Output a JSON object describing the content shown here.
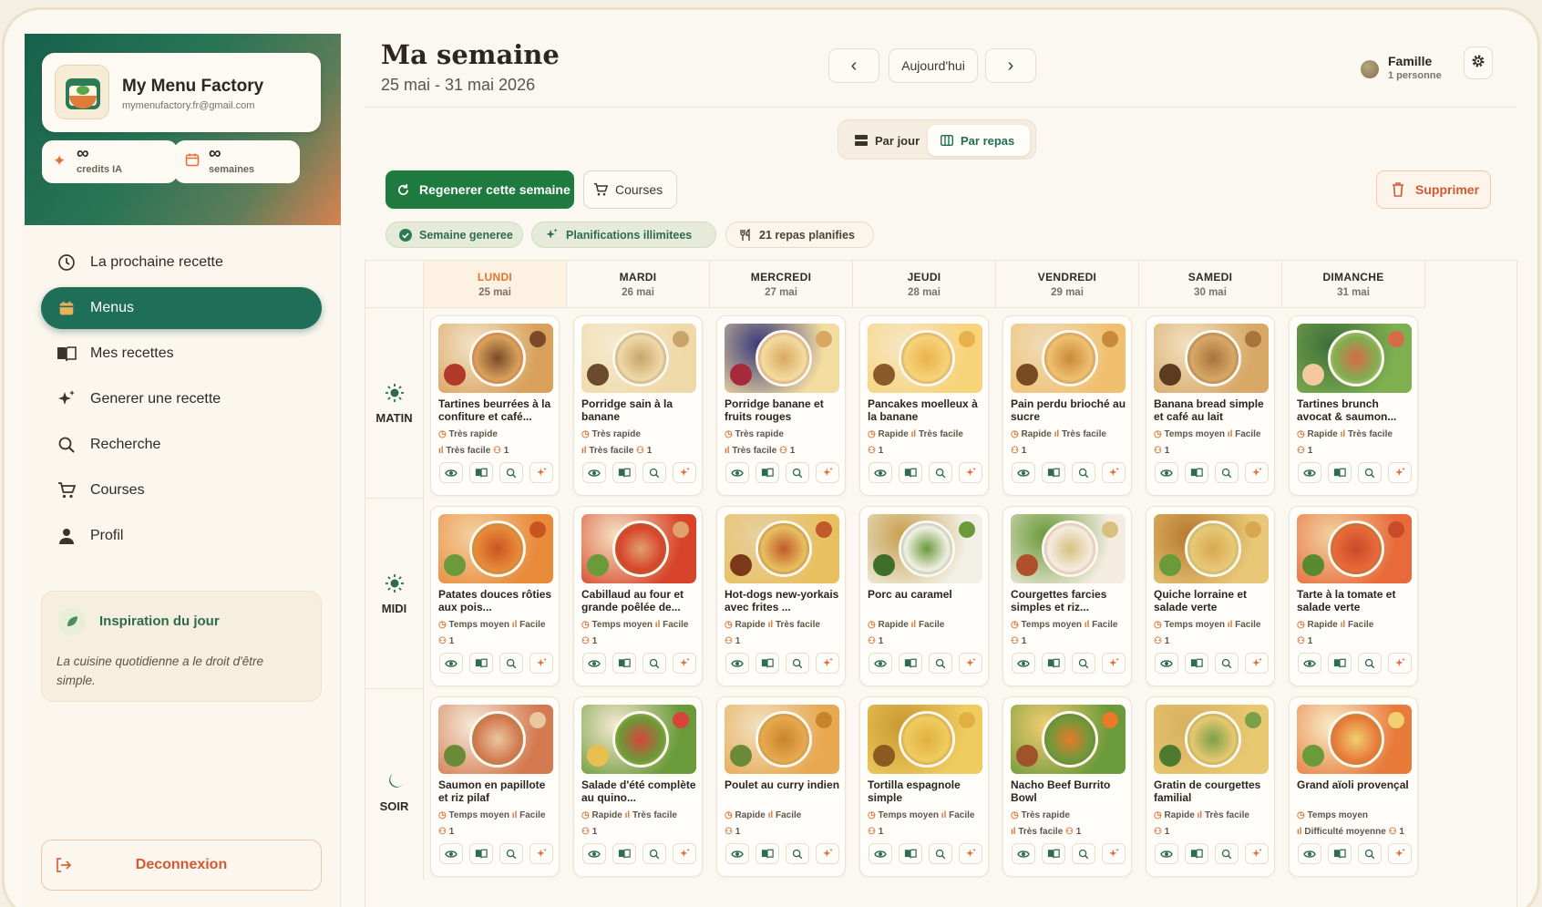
{
  "brand": {
    "name": "My Menu Factory",
    "email": "mymenufactory.fr@gmail.com"
  },
  "stats": [
    {
      "value": "∞",
      "label": "credits IA",
      "icon": "sparkle-icon"
    },
    {
      "value": "∞",
      "label": "semaines",
      "icon": "calendar-icon"
    }
  ],
  "nav": [
    {
      "label": "La prochaine recette",
      "icon": "clock-icon",
      "active": false
    },
    {
      "label": "Menus",
      "icon": "calendar-icon",
      "active": true
    },
    {
      "label": "Mes recettes",
      "icon": "book-icon",
      "active": false
    },
    {
      "label": "Generer une recette",
      "icon": "sparkle-icon",
      "active": false
    },
    {
      "label": "Recherche",
      "icon": "search-icon",
      "active": false
    },
    {
      "label": "Courses",
      "icon": "cart-icon",
      "active": false
    },
    {
      "label": "Profil",
      "icon": "user-icon",
      "active": false
    }
  ],
  "inspiration": {
    "title": "Inspiration du jour",
    "text": "La cuisine quotidienne a le droit d'être simple."
  },
  "logout": {
    "label": "Deconnexion"
  },
  "header": {
    "title": "Ma semaine",
    "range": "25 mai - 31 mai 2026",
    "prev": "‹",
    "today": "Aujourd'hui",
    "next": "›",
    "user": {
      "name": "Famille",
      "sub": "1 personne"
    }
  },
  "view_toggle": {
    "by_day": "Par jour",
    "by_meal": "Par repas",
    "selected": "Par repas"
  },
  "actions": {
    "regenerate": "Regenerer cette semaine",
    "courses": "Courses",
    "delete": "Supprimer"
  },
  "chips": [
    "Semaine generee",
    "Planifications illimitees",
    "21 repas planifies"
  ],
  "colors": {
    "primary": "#1f6e58",
    "action_green": "#1e7a3f",
    "accent_orange": "#e0772b",
    "danger": "#d25a32",
    "background": "#fbf8f1"
  },
  "days": [
    {
      "name": "LUNDI",
      "date": "25 mai",
      "today": true
    },
    {
      "name": "MARDI",
      "date": "26 mai",
      "today": false
    },
    {
      "name": "MERCREDI",
      "date": "27 mai",
      "today": false
    },
    {
      "name": "JEUDI",
      "date": "28 mai",
      "today": false
    },
    {
      "name": "VENDREDI",
      "date": "29 mai",
      "today": false
    },
    {
      "name": "SAMEDI",
      "date": "30 mai",
      "today": false
    },
    {
      "name": "DIMANCHE",
      "date": "31 mai",
      "today": false
    }
  ],
  "slots": [
    {
      "label": "MATIN",
      "icon": "sun-icon",
      "meals": [
        {
          "name": "Tartines beurrées à la confiture et café...",
          "time": "Très rapide",
          "difficulty": "Très facile",
          "servings": "1"
        },
        {
          "name": "Porridge sain à la banane",
          "time": "Très rapide",
          "difficulty": "Très facile",
          "servings": "1"
        },
        {
          "name": "Porridge banane et fruits rouges",
          "time": "Très rapide",
          "difficulty": "Très facile",
          "servings": "1"
        },
        {
          "name": "Pancakes moelleux à la banane",
          "time": "Rapide",
          "difficulty": "Très facile",
          "servings": "1"
        },
        {
          "name": "Pain perdu brioché au sucre",
          "time": "Rapide",
          "difficulty": "Très facile",
          "servings": "1"
        },
        {
          "name": "Banana bread simple et café au lait",
          "time": "Temps moyen",
          "difficulty": "Facile",
          "servings": "1"
        },
        {
          "name": "Tartines brunch avocat & saumon...",
          "time": "Rapide",
          "difficulty": "Très facile",
          "servings": "1"
        }
      ]
    },
    {
      "label": "MIDI",
      "icon": "sun-icon",
      "meals": [
        {
          "name": "Patates douces rôties aux pois...",
          "time": "Temps moyen",
          "difficulty": "Facile",
          "servings": "1"
        },
        {
          "name": "Cabillaud au four et grande poêlée de...",
          "time": "Temps moyen",
          "difficulty": "Facile",
          "servings": "1"
        },
        {
          "name": "Hot-dogs new-yorkais avec frites ...",
          "time": "Rapide",
          "difficulty": "Très facile",
          "servings": "1"
        },
        {
          "name": "Porc au caramel",
          "time": "Rapide",
          "difficulty": "Facile",
          "servings": "1"
        },
        {
          "name": "Courgettes farcies simples et riz...",
          "time": "Temps moyen",
          "difficulty": "Facile",
          "servings": "1"
        },
        {
          "name": "Quiche lorraine et salade verte",
          "time": "Temps moyen",
          "difficulty": "Facile",
          "servings": "1"
        },
        {
          "name": "Tarte à la tomate et salade verte",
          "time": "Rapide",
          "difficulty": "Facile",
          "servings": "1"
        }
      ]
    },
    {
      "label": "SOIR",
      "icon": "moon-icon",
      "meals": [
        {
          "name": "Saumon en papillote et riz pilaf",
          "time": "Temps moyen",
          "difficulty": "Facile",
          "servings": "1"
        },
        {
          "name": "Salade d'été complète au quino...",
          "time": "Rapide",
          "difficulty": "Très facile",
          "servings": "1"
        },
        {
          "name": "Poulet au curry indien",
          "time": "Rapide",
          "difficulty": "Facile",
          "servings": "1"
        },
        {
          "name": "Tortilla espagnole simple",
          "time": "Temps moyen",
          "difficulty": "Facile",
          "servings": "1"
        },
        {
          "name": "Nacho Beef Burrito Bowl",
          "time": "Très rapide",
          "difficulty": "Très facile",
          "servings": "1"
        },
        {
          "name": "Gratin de courgettes familial",
          "time": "Rapide",
          "difficulty": "Très facile",
          "servings": "1"
        },
        {
          "name": "Grand aïoli provençal",
          "time": "Temps moyen",
          "difficulty": "Difficulté moyenne",
          "servings": "1"
        }
      ]
    }
  ]
}
